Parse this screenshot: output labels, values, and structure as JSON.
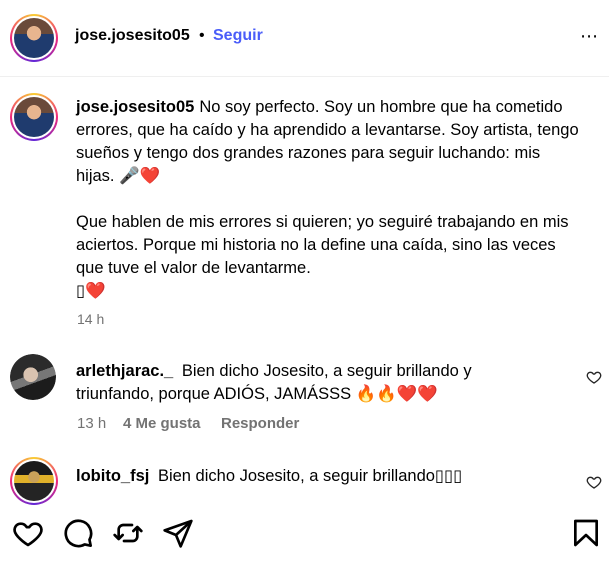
{
  "header": {
    "username": "jose.josesito05",
    "separator": "•",
    "follow_label": "Seguir",
    "more_icon": "⋯"
  },
  "caption": {
    "username": "jose.josesito05",
    "paragraph1": "No soy perfecto. Soy un hombre que ha cometido errores, que ha caído y ha aprendido a levantarse. Soy artista, tengo sueños y tengo dos grandes razones para seguir luchando: mis hijas. 🎤❤️",
    "paragraph2": "Que hablen de mis errores si quieren; yo seguiré trabajando en mis aciertos. Porque mi historia no la define una caída, sino las veces que tuve el valor de levantarme.",
    "paragraph3": "▯❤️",
    "time": "14 h"
  },
  "comments": [
    {
      "username": "arlethjarac._",
      "text": "Bien dicho Josesito, a seguir brillando y triunfando, porque ADIÓS, JAMÁSSS 🔥🔥❤️❤️",
      "time": "13 h",
      "likes": "4 Me gusta",
      "reply": "Responder"
    },
    {
      "username": "lobito_fsj",
      "text": "Bien dicho Josesito, a seguir brillando▯▯▯"
    }
  ],
  "icons": {
    "like": "heart-icon",
    "comment": "comment-icon",
    "repost": "repost-icon",
    "share": "share-icon",
    "save": "bookmark-icon"
  }
}
